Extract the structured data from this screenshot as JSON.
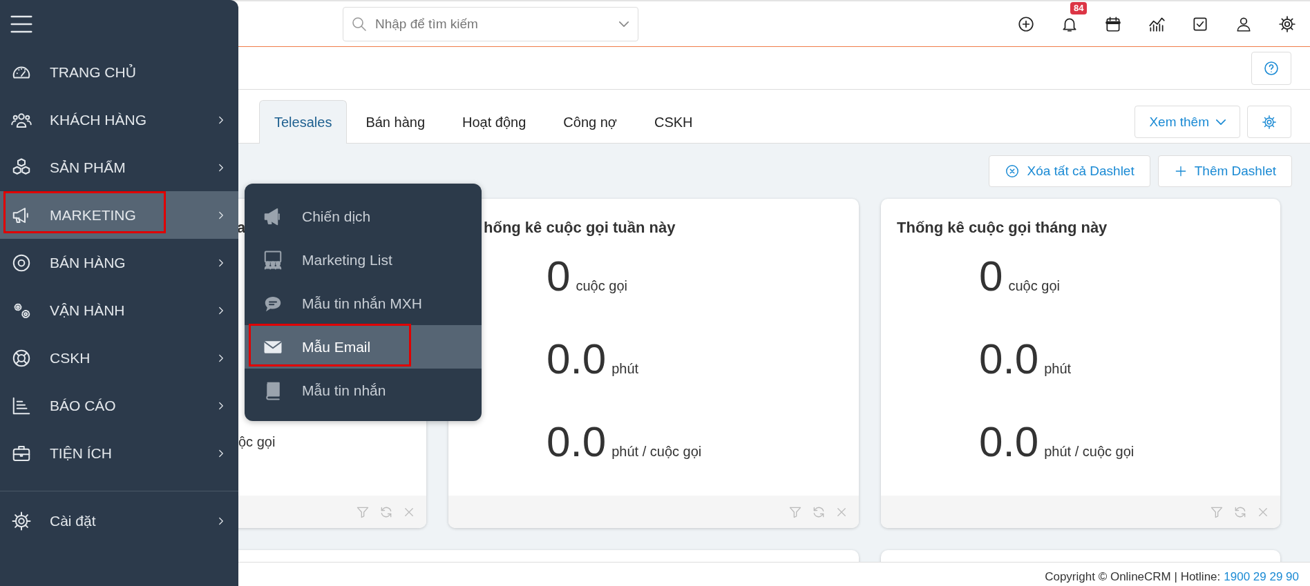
{
  "header": {
    "search": {
      "placeholder": "Nhập để tìm kiếm"
    },
    "notifications": {
      "count": "84"
    }
  },
  "sidebar": {
    "items": [
      {
        "label": "TRANG CHỦ",
        "has_submenu": false,
        "selected": false,
        "highlighted": false
      },
      {
        "label": "KHÁCH HÀNG",
        "has_submenu": true,
        "selected": false,
        "highlighted": false
      },
      {
        "label": "SẢN PHẨM",
        "has_submenu": true,
        "selected": false,
        "highlighted": false
      },
      {
        "label": "MARKETING",
        "has_submenu": true,
        "selected": true,
        "highlighted": true
      },
      {
        "label": "BÁN HÀNG",
        "has_submenu": true,
        "selected": false,
        "highlighted": false
      },
      {
        "label": "VẬN HÀNH",
        "has_submenu": true,
        "selected": false,
        "highlighted": false
      },
      {
        "label": "CSKH",
        "has_submenu": true,
        "selected": false,
        "highlighted": false
      },
      {
        "label": "BÁO CÁO",
        "has_submenu": true,
        "selected": false,
        "highlighted": false
      },
      {
        "label": "TIỆN ÍCH",
        "has_submenu": true,
        "selected": false,
        "highlighted": false
      }
    ],
    "footer_items": [
      {
        "label": "Cài đặt",
        "has_submenu": true,
        "selected": false,
        "highlighted": false
      }
    ]
  },
  "submenu": {
    "items": [
      {
        "label": "Chiến dịch",
        "selected": false,
        "highlighted": false
      },
      {
        "label": "Marketing List",
        "selected": false,
        "highlighted": false
      },
      {
        "label": "Mẫu tin nhắn MXH",
        "selected": false,
        "highlighted": false
      },
      {
        "label": "Mẫu Email",
        "selected": true,
        "highlighted": true
      },
      {
        "label": "Mẫu tin nhắn",
        "selected": false,
        "highlighted": false
      }
    ]
  },
  "tabs": [
    {
      "label": "Telesales",
      "selected": true
    },
    {
      "label": "Bán hàng",
      "selected": false
    },
    {
      "label": "Hoạt động",
      "selected": false
    },
    {
      "label": "Công nợ",
      "selected": false
    },
    {
      "label": "CSKH",
      "selected": false
    }
  ],
  "toolbar": {
    "more_button": "Xem thêm",
    "clear_button": "Xóa tất cả Dashlet",
    "add_button": "Thêm Dashlet"
  },
  "dashlets": [
    {
      "title": "a",
      "stats": [
        {
          "unit": "ộc gọi"
        }
      ]
    },
    {
      "title": "hống kê cuộc gọi tuần này",
      "stats": [
        {
          "value": "0",
          "unit": "cuộc gọi"
        },
        {
          "value": "0.0",
          "unit": "phút"
        },
        {
          "value": "0.0",
          "unit": "phút / cuộc gọi"
        }
      ]
    },
    {
      "title": "Thống kê cuộc gọi tháng này",
      "stats": [
        {
          "value": "0",
          "unit": "cuộc gọi"
        },
        {
          "value": "0.0",
          "unit": "phút"
        },
        {
          "value": "0.0",
          "unit": "phút / cuộc gọi"
        }
      ]
    }
  ],
  "footer": {
    "copyright": "Copyright © OnlineCRM | Hotline:",
    "hotline": "1900 29 29 90"
  }
}
